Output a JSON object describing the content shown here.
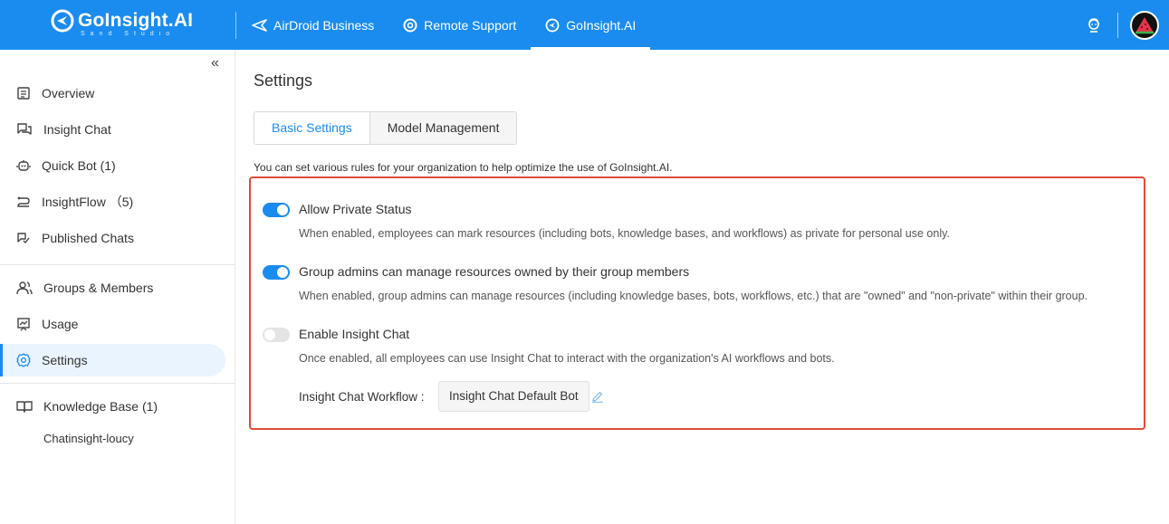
{
  "brand": {
    "name": "GoInsight.AI",
    "subtitle": "Sand Studio",
    "accent": "#1a8cf0"
  },
  "top_nav": {
    "items": [
      {
        "label": "AirDroid Business",
        "icon": "airdroid-icon"
      },
      {
        "label": "Remote Support",
        "icon": "remote-support-icon"
      },
      {
        "label": "GoInsight.AI",
        "icon": "goinsight-icon",
        "active": true
      }
    ]
  },
  "sidebar": {
    "items": [
      {
        "label": "Overview",
        "icon": "overview-icon"
      },
      {
        "label": "Insight Chat",
        "icon": "chat-icon"
      },
      {
        "label": "Quick Bot (1)",
        "icon": "bot-icon"
      },
      {
        "label": "InsightFlow （5)",
        "icon": "flow-icon"
      },
      {
        "label": "Published Chats",
        "icon": "published-icon"
      },
      {
        "label": "Groups & Members",
        "icon": "members-icon"
      },
      {
        "label": "Usage",
        "icon": "usage-icon"
      },
      {
        "label": "Settings",
        "icon": "gear-icon",
        "active": true
      },
      {
        "label": "Knowledge Base (1)",
        "icon": "book-icon"
      }
    ],
    "sub_items": [
      "Chatinsight-loucy"
    ]
  },
  "main": {
    "title": "Settings",
    "tabs": [
      {
        "label": "Basic Settings",
        "active": true
      },
      {
        "label": "Model Management"
      }
    ],
    "hint": "You can set various rules for your organization to help optimize the use of GoInsight.AI.",
    "settings": [
      {
        "title": "Allow Private Status",
        "description": "When enabled, employees can mark resources (including bots, knowledge bases, and workflows) as private for personal use only.",
        "enabled": true
      },
      {
        "title": "Group admins can manage resources owned by their group members",
        "description": "When enabled, group admins can manage resources (including knowledge bases, bots, workflows, etc.) that are \"owned\" and \"non-private\" within their group.",
        "enabled": true
      },
      {
        "title": "Enable Insight Chat",
        "description": "Once enabled, all employees can use Insight Chat to interact with the organization's AI workflows and bots.",
        "enabled": false
      }
    ],
    "workflow": {
      "label": "Insight Chat Workflow :",
      "value": "Insight Chat Default Bot"
    }
  }
}
